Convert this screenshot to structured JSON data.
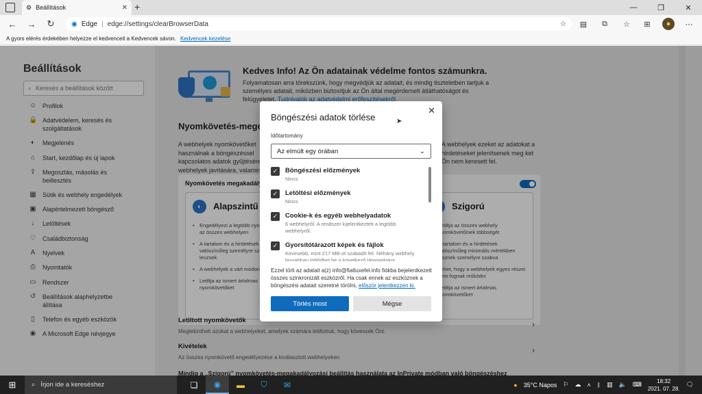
{
  "tab": {
    "title": "Beállítások",
    "favicon": "gear-icon"
  },
  "address": {
    "brand": "Edge",
    "url": "edge://settings/clearBrowserData"
  },
  "favbar": {
    "text": "A gyors elérés érdekében helyezze el kedvenceit a Kedvencek sávon.",
    "link": "Kedvencek kezelése"
  },
  "sidebar": {
    "title": "Beállítások",
    "search_placeholder": "Keresés a beállítások között",
    "items": [
      {
        "label": "Profilok",
        "icon": "person-icon"
      },
      {
        "label": "Adatvédelem, keresés és szolgáltatások",
        "icon": "lock-icon"
      },
      {
        "label": "Megjelenés",
        "icon": "palette-icon"
      },
      {
        "label": "Start, kezdőlap és új lapok",
        "icon": "home-icon"
      },
      {
        "label": "Megosztás, másolás és beillesztés",
        "icon": "share-icon"
      },
      {
        "label": "Sütik és webhely engedélyek",
        "icon": "site-permissions-icon"
      },
      {
        "label": "Alapértelmezett böngésző",
        "icon": "browser-icon"
      },
      {
        "label": "Letöltések",
        "icon": "download-icon"
      },
      {
        "label": "Családbiztonság",
        "icon": "family-icon"
      },
      {
        "label": "Nyelvek",
        "icon": "language-icon"
      },
      {
        "label": "Nyomtatók",
        "icon": "printer-icon"
      },
      {
        "label": "Rendszer",
        "icon": "system-icon"
      },
      {
        "label": "Beállítások alaphelyzetbe állítása",
        "icon": "reset-icon"
      },
      {
        "label": "Telefon és egyéb eszközök",
        "icon": "phone-icon"
      },
      {
        "label": "A Microsoft Edge névjegye",
        "icon": "edge-icon"
      }
    ]
  },
  "main": {
    "privacy_title": "Kedves Info! Az Ön adatainak védelme fontos számunkra.",
    "privacy_text": "Folyamatosan arra törekszünk, hogy megvédjük az adatait, és mindig tiszteletben tartjuk a személyes adatait, miközben biztosítjuk az Ön által megérdemelt átláthatóságot és felügyeletet.",
    "privacy_link": "Tudnivalók az adatvédelmi erőfeszítésekről",
    "tracking_title": "Nyomkövetés-megelőzés",
    "tracking_text_left": "A webhelyek nyomkövetőket használnak a böngészéssel kapcsolatos adatok gyűjtésére. A webhelyek javítására, valamint személyre szabott hirdetések megjelenítésére használhatják ezeket. Önnek. Bizonyos nyomkövetők",
    "tracking_text_right": "A webhelyek ezeket az adatokat a hirdetéseket jelenítsenek meg ket Ön nem keresett fel.",
    "tracking_toggle_label": "Nyomkövetés megakadályozása",
    "card_basic": {
      "title": "Alapszintű",
      "bullets": [
        "Engedélyezi a legtöbb nyomkövetőt az összes webhelyen",
        "A tartalom és a hirdetések valószínűleg személyre szabottak lesznek",
        "A webhelyek a várt módon működni",
        "Letiltja az ismert ártalmas nyomkövetőket"
      ]
    },
    "card_strict": {
      "title": "Szigorú",
      "bullets": [
        "Letiltja az összes webhely nyomkövetőinek többségét",
        "A tartalom és a hirdetések valószínűleg minimális mértékben lesznek személyre szabva",
        "Lehet, hogy a webhelyek egyes részei nem fognak működni",
        "Letiltja az ismert ártalmas nyomkövetőket"
      ]
    },
    "blocked_title": "Letiltott nyomkövetők",
    "blocked_desc": "Megtekintheti azokat a webhelyeket, amelyek számára letiltottuk, hogy kövessék Önt.",
    "exceptions_title": "Kivételek",
    "exceptions_desc": "Az összes nyomkövető engedélyezése a kiválasztott webhelyeken",
    "inprivate_text": "Mindig a „Szigorú” nyomkövetés-megakadályozási beállítás használata az InPrivate módban való böngészéshez"
  },
  "dialog": {
    "title": "Böngészési adatok törlése",
    "range_label": "Időtartomány",
    "range_value": "Az elmúlt egy órában",
    "options": [
      {
        "label": "Böngészési előzmények",
        "desc": "Nincs",
        "checked": true
      },
      {
        "label": "Letöltési előzmények",
        "desc": "Nincs",
        "checked": true
      },
      {
        "label": "Cookie-k és egyéb webhelyadatok",
        "desc": "6 webhelyről. A rendszer kijelentkezteti a legtöbb webhelyről.",
        "checked": true
      },
      {
        "label": "Gyorsítótárazott képek és fájlok",
        "desc": "Kevesebb, mint 217 MB-ot szabadít fel. Néhány webhely lassabban töltődhet be a következő látogatáskor.",
        "checked": true
      }
    ],
    "info_text": "Ezzel törli az adatait a(z) info@fiatluxefel.info fiókba bejelentkezett összes szinkronizált eszközről. Ha csak ennek az eszköznek a böngészési adatait szeretné törölni,",
    "info_link": "először jelentkezzen ki.",
    "delete_label": "Törlés most",
    "cancel_label": "Mégse"
  },
  "taskbar": {
    "search_placeholder": "Írjon ide a kereséshez",
    "weather": "35°C  Napos",
    "time": "18:32",
    "date": "2021. 07. 28."
  },
  "colors": {
    "accent": "#0f6cbd",
    "taskbar": "#202020"
  }
}
